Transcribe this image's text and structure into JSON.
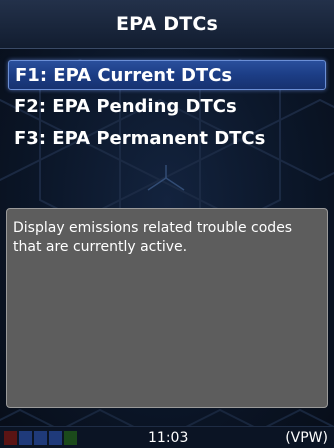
{
  "header": {
    "title": "EPA DTCs"
  },
  "menu": {
    "items": [
      {
        "label": "F1: EPA Current DTCs",
        "selected": true
      },
      {
        "label": "F2: EPA Pending DTCs",
        "selected": false
      },
      {
        "label": "F3: EPA Permanent DTCs",
        "selected": false
      }
    ]
  },
  "description": {
    "text": "Display emissions related trouble codes that are currently active."
  },
  "status": {
    "time": "11:03",
    "protocol": "(VPW)",
    "indicator_colors": [
      "#5a1414",
      "#1f3a7a",
      "#1f3a7a",
      "#1f3a7a",
      "#1b4a1b"
    ]
  },
  "colors": {
    "selection": "#1f3f88",
    "description_bg": "#5d5d5d",
    "background": "#0b1628"
  }
}
